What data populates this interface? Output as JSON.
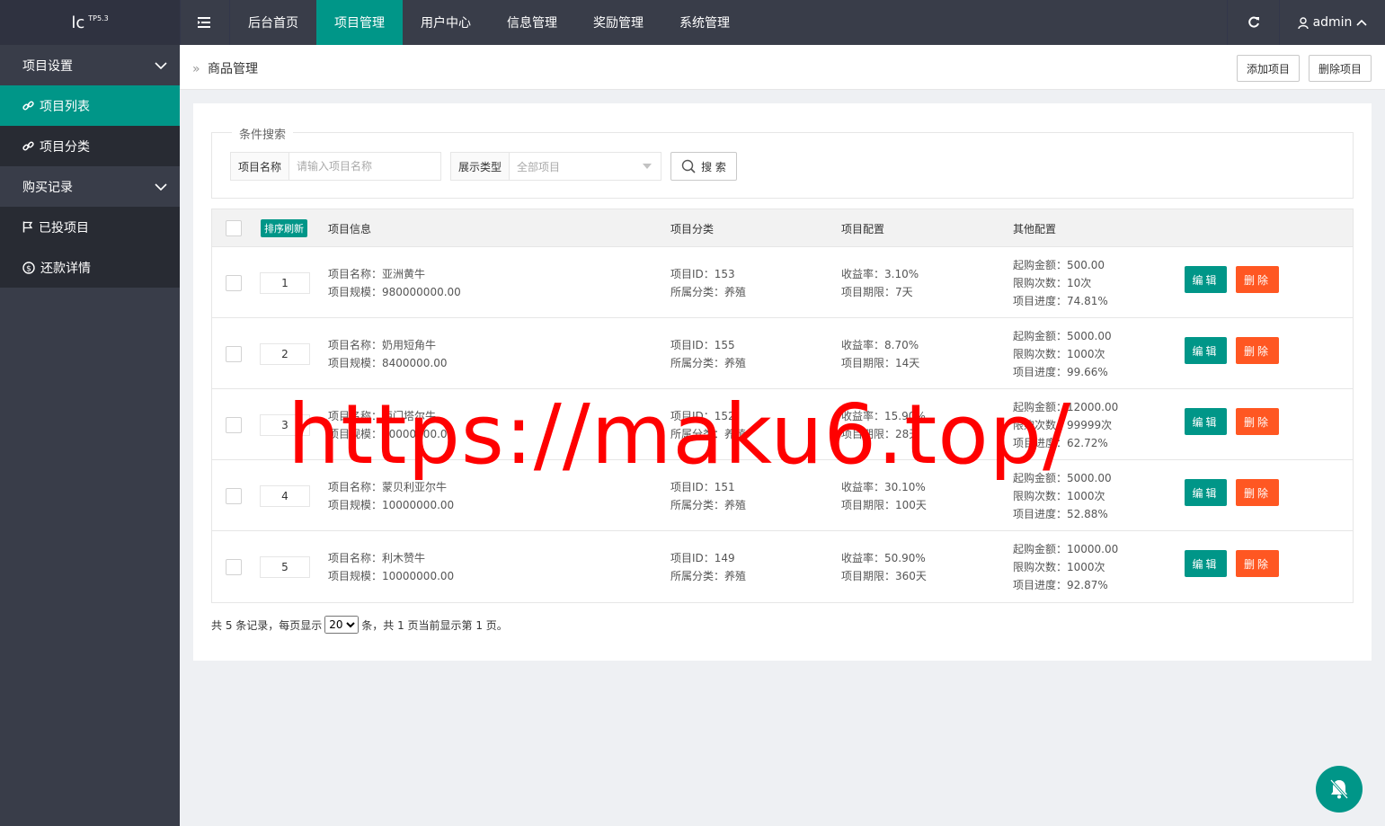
{
  "logo": {
    "text": "lc",
    "version": "TP5.3"
  },
  "topnav": [
    {
      "label": "后台首页",
      "active": false
    },
    {
      "label": "项目管理",
      "active": true
    },
    {
      "label": "用户中心",
      "active": false
    },
    {
      "label": "信息管理",
      "active": false
    },
    {
      "label": "奖励管理",
      "active": false
    },
    {
      "label": "系统管理",
      "active": false
    }
  ],
  "user": {
    "name": "admin"
  },
  "sidebar": {
    "group1": "项目设置",
    "item1": "项目列表",
    "item2": "项目分类",
    "group2": "购买记录",
    "item3": "已投项目",
    "item4": "还款详情"
  },
  "breadcrumb": {
    "title": "商品管理"
  },
  "toolbar": {
    "add_label": "添加项目",
    "delete_label": "删除项目"
  },
  "search": {
    "legend": "条件搜索",
    "name_label": "项目名称",
    "name_placeholder": "请输入项目名称",
    "type_label": "展示类型",
    "type_value": "全部项目",
    "button": "搜 索"
  },
  "table": {
    "sort_button": "排序刷新",
    "headers": [
      "项目信息",
      "项目分类",
      "项目配置",
      "其他配置"
    ],
    "edit_label": "编辑",
    "delete_label": "删除",
    "rows": [
      {
        "sort": "1",
        "name": "项目名称：亚洲黄牛",
        "scale": "项目规模：980000000.00",
        "id": "项目ID：153",
        "cat": "所属分类：养殖",
        "rate": "收益率：3.10%",
        "term": "项目期限：7天",
        "min": "起购金额：500.00",
        "limit": "限购次数：10次",
        "progress": "项目进度：74.81%"
      },
      {
        "sort": "2",
        "name": "项目名称：奶用短角牛",
        "scale": "项目规模：8400000.00",
        "id": "项目ID：155",
        "cat": "所属分类：养殖",
        "rate": "收益率：8.70%",
        "term": "项目期限：14天",
        "min": "起购金额：5000.00",
        "limit": "限购次数：1000次",
        "progress": "项目进度：99.66%"
      },
      {
        "sort": "3",
        "name": "项目名称：西门塔尔牛",
        "scale": "项目规模：10000000.00",
        "id": "项目ID：152",
        "cat": "所属分类：养殖",
        "rate": "收益率：15.90%",
        "term": "项目期限：28天",
        "min": "起购金额：12000.00",
        "limit": "限购次数：99999次",
        "progress": "项目进度：62.72%"
      },
      {
        "sort": "4",
        "name": "项目名称：蒙贝利亚尔牛",
        "scale": "项目规模：10000000.00",
        "id": "项目ID：151",
        "cat": "所属分类：养殖",
        "rate": "收益率：30.10%",
        "term": "项目期限：100天",
        "min": "起购金额：5000.00",
        "limit": "限购次数：1000次",
        "progress": "项目进度：52.88%"
      },
      {
        "sort": "5",
        "name": "项目名称：利木赞牛",
        "scale": "项目规模：10000000.00",
        "id": "项目ID：149",
        "cat": "所属分类：养殖",
        "rate": "收益率：50.90%",
        "term": "项目期限：360天",
        "min": "起购金额：10000.00",
        "limit": "限购次数：1000次",
        "progress": "项目进度：92.87%"
      }
    ]
  },
  "pager": {
    "prefix": "共 5 条记录，每页显示",
    "per_page": "20",
    "suffix": "条，共 1 页当前显示第 1 页。"
  },
  "watermark": "https://maku6.top/",
  "colors": {
    "accent": "#009688",
    "danger": "#ff5722",
    "dark": "#393d49"
  }
}
